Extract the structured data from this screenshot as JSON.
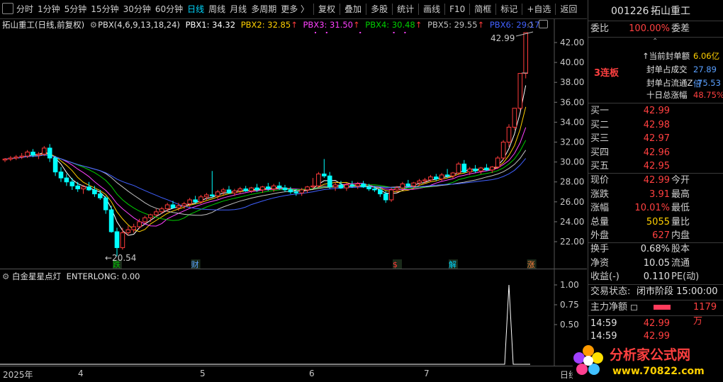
{
  "toolbar": {
    "items": [
      {
        "label": "分时",
        "selected": false
      },
      {
        "label": "1分钟",
        "selected": false
      },
      {
        "label": "5分钟",
        "selected": false
      },
      {
        "label": "15分钟",
        "selected": false
      },
      {
        "label": "30分钟",
        "selected": false
      },
      {
        "label": "60分钟",
        "selected": false
      },
      {
        "label": "日线",
        "selected": true
      },
      {
        "label": "周线",
        "selected": false
      },
      {
        "label": "月线",
        "selected": false
      },
      {
        "label": "多周期",
        "selected": false
      },
      {
        "label": "更多 〉",
        "selected": false
      }
    ],
    "actions": [
      "复权",
      "叠加",
      "多股",
      "统计",
      "画线",
      "F10",
      "简框",
      "标记",
      "+自选",
      "返回"
    ]
  },
  "chart_info": {
    "stock_name": "拓山重工",
    "mode": "(日线,前复权)",
    "indicator": "PBX(4,6,9,13,18,24)",
    "pbx1": "PBX1: 34.32",
    "pbx2": "PBX2: 32.85",
    "pbx3": "PBX3: 31.50",
    "pbx4": "PBX4: 30.48",
    "pbx5": "PBX5: 29.55",
    "pbx6": "PBX6: 29.17",
    "arrow": "↑",
    "high_label": "42.99",
    "low_label": "←20.54"
  },
  "colors": {
    "up": "#ff3b3b",
    "down": "#00ffff",
    "pbx1": "#ffffff",
    "pbx2": "#ffd000",
    "pbx3": "#ff40ff",
    "pbx4": "#00d000",
    "pbx5": "#c0c0c0",
    "pbx6": "#4060ff"
  },
  "chart_data": {
    "type": "candlestick",
    "y_ticks": [
      "42.00",
      "40.00",
      "38.00",
      "36.00",
      "34.00",
      "32.00",
      "30.00",
      "28.00",
      "26.00",
      "24.00",
      "22.00"
    ],
    "ylim": [
      20.5,
      43.2
    ],
    "x_labels": [
      "2025年",
      "4",
      "5",
      "6",
      "7",
      "日线"
    ],
    "candles": [
      [
        30.2,
        30.4,
        30.0,
        30.3
      ],
      [
        30.3,
        30.6,
        30.1,
        30.4
      ],
      [
        30.4,
        30.7,
        30.2,
        30.5
      ],
      [
        30.5,
        30.9,
        30.3,
        30.6
      ],
      [
        30.6,
        31.2,
        30.4,
        31.0
      ],
      [
        31.0,
        31.3,
        30.5,
        30.7
      ],
      [
        30.7,
        31.0,
        30.3,
        30.8
      ],
      [
        30.8,
        31.6,
        30.6,
        31.4
      ],
      [
        31.4,
        31.8,
        30.0,
        30.4
      ],
      [
        30.4,
        30.6,
        28.6,
        29.0
      ],
      [
        29.0,
        29.5,
        28.0,
        28.4
      ],
      [
        28.4,
        28.8,
        27.6,
        28.0
      ],
      [
        28.0,
        28.4,
        27.2,
        27.6
      ],
      [
        27.6,
        28.0,
        27.0,
        27.3
      ],
      [
        27.3,
        27.7,
        26.8,
        27.5
      ],
      [
        27.5,
        28.0,
        27.1,
        27.2
      ],
      [
        27.2,
        27.6,
        26.5,
        26.8
      ],
      [
        26.8,
        27.2,
        26.2,
        26.4
      ],
      [
        26.4,
        26.6,
        24.8,
        25.2
      ],
      [
        25.2,
        25.6,
        22.9,
        23.0
      ],
      [
        23.0,
        23.4,
        20.54,
        21.4
      ],
      [
        21.4,
        23.4,
        21.2,
        22.9
      ],
      [
        22.9,
        23.6,
        22.6,
        23.2
      ],
      [
        23.2,
        23.8,
        22.9,
        23.5
      ],
      [
        23.5,
        24.3,
        23.3,
        24.0
      ],
      [
        24.0,
        24.6,
        23.8,
        24.4
      ],
      [
        24.4,
        24.8,
        24.0,
        24.7
      ],
      [
        24.7,
        25.3,
        24.5,
        25.0
      ],
      [
        25.0,
        25.5,
        24.8,
        25.3
      ],
      [
        25.3,
        25.9,
        25.0,
        25.7
      ],
      [
        25.7,
        26.1,
        25.3,
        25.4
      ],
      [
        25.4,
        25.9,
        25.1,
        25.6
      ],
      [
        25.6,
        26.0,
        25.3,
        25.8
      ],
      [
        25.8,
        26.4,
        25.5,
        26.2
      ],
      [
        26.2,
        26.6,
        25.8,
        26.0
      ],
      [
        26.0,
        26.7,
        25.8,
        26.5
      ],
      [
        26.5,
        26.9,
        26.2,
        26.7
      ],
      [
        26.7,
        29.1,
        26.4,
        26.6
      ],
      [
        26.6,
        27.2,
        26.3,
        27.0
      ],
      [
        27.0,
        27.4,
        26.7,
        27.2
      ],
      [
        27.2,
        27.6,
        26.8,
        26.9
      ],
      [
        26.9,
        27.3,
        26.6,
        27.1
      ],
      [
        27.1,
        27.5,
        26.8,
        27.3
      ],
      [
        27.3,
        27.6,
        27.0,
        27.1
      ],
      [
        27.1,
        27.5,
        26.9,
        27.4
      ],
      [
        27.4,
        27.8,
        27.0,
        27.2
      ],
      [
        27.2,
        27.6,
        26.9,
        27.5
      ],
      [
        27.5,
        27.9,
        27.1,
        27.3
      ],
      [
        27.3,
        27.8,
        27.0,
        27.6
      ],
      [
        27.6,
        28.0,
        27.2,
        27.4
      ],
      [
        27.4,
        27.7,
        27.0,
        27.2
      ],
      [
        27.2,
        27.5,
        26.8,
        27.0
      ],
      [
        27.0,
        27.3,
        26.6,
        26.9
      ],
      [
        26.9,
        27.4,
        26.6,
        27.2
      ],
      [
        27.2,
        27.6,
        26.9,
        27.5
      ],
      [
        27.5,
        28.4,
        27.3,
        27.6
      ],
      [
        27.6,
        29.0,
        27.4,
        28.8
      ],
      [
        28.8,
        30.3,
        28.4,
        28.6
      ],
      [
        28.6,
        29.0,
        27.3,
        27.5
      ],
      [
        27.5,
        28.0,
        27.1,
        27.7
      ],
      [
        27.7,
        28.1,
        27.3,
        27.4
      ],
      [
        27.4,
        27.9,
        27.1,
        27.7
      ],
      [
        27.7,
        28.1,
        27.4,
        27.6
      ],
      [
        27.6,
        28.0,
        27.3,
        27.8
      ],
      [
        27.8,
        28.1,
        27.4,
        27.5
      ],
      [
        27.5,
        27.8,
        27.1,
        27.3
      ],
      [
        27.3,
        27.6,
        27.0,
        27.2
      ],
      [
        27.2,
        27.5,
        26.5,
        26.8
      ],
      [
        26.8,
        27.1,
        25.9,
        26.2
      ],
      [
        26.2,
        27.4,
        26.0,
        27.2
      ],
      [
        27.2,
        27.6,
        26.9,
        27.4
      ],
      [
        27.4,
        28.0,
        27.2,
        27.8
      ],
      [
        27.8,
        28.2,
        27.5,
        27.6
      ],
      [
        27.6,
        28.0,
        27.3,
        27.9
      ],
      [
        27.9,
        28.3,
        27.6,
        28.1
      ],
      [
        28.1,
        28.4,
        27.8,
        28.2
      ],
      [
        28.2,
        28.7,
        28.0,
        28.5
      ],
      [
        28.5,
        28.8,
        28.1,
        28.3
      ],
      [
        28.3,
        28.9,
        28.1,
        28.7
      ],
      [
        28.7,
        29.3,
        28.4,
        28.6
      ],
      [
        28.6,
        29.0,
        28.3,
        28.9
      ],
      [
        28.9,
        30.0,
        28.7,
        29.8
      ],
      [
        29.8,
        30.2,
        28.9,
        29.0
      ],
      [
        29.0,
        29.5,
        28.7,
        29.3
      ],
      [
        29.3,
        29.7,
        28.9,
        29.1
      ],
      [
        29.1,
        29.5,
        28.8,
        29.4
      ],
      [
        29.4,
        29.8,
        29.1,
        29.2
      ],
      [
        29.2,
        29.6,
        28.9,
        29.5
      ],
      [
        29.5,
        30.6,
        29.3,
        30.4
      ],
      [
        30.4,
        32.2,
        30.2,
        32.0
      ],
      [
        32.0,
        33.8,
        31.5,
        33.5
      ],
      [
        33.5,
        35.4,
        33.2,
        35.4
      ],
      [
        35.4,
        38.9,
        35.2,
        38.9
      ],
      [
        38.9,
        42.99,
        38.4,
        42.99
      ]
    ],
    "sub_indicator": {
      "name": "白金星星点灯",
      "value_label": "ENTERLONG: 0.00",
      "y_ticks": [
        "1.00",
        "0.75",
        "0.50"
      ],
      "signal_index": 90,
      "signal_value": 1.0
    },
    "event_markers": [
      {
        "label": "跌",
        "index": 20
      },
      {
        "label": "财",
        "index": 34
      },
      {
        "label": "$",
        "index": 70
      },
      {
        "label": "解",
        "index": 80
      },
      {
        "label": "涨",
        "index": 94
      }
    ]
  },
  "quote": {
    "code": "001226",
    "name": "拓山重工",
    "weibi_label": "委比",
    "weibi": "100.00%",
    "weicha_label": "委差",
    "seal_amount_label": "当前封单额",
    "seal_amount": "6.06亿",
    "seal_trade_label": "封单占成交",
    "seal_trade": "27.89倍",
    "seal_float_label": "封单占流通Z",
    "seal_float": "75.53",
    "ten_day_label": "十日总涨幅",
    "ten_day": "48.75%",
    "streak": "3连板",
    "bids": [
      {
        "label": "买一",
        "price": "42.99"
      },
      {
        "label": "买二",
        "price": "42.98"
      },
      {
        "label": "买三",
        "price": "42.97"
      },
      {
        "label": "买四",
        "price": "42.96"
      },
      {
        "label": "买五",
        "price": "42.95"
      }
    ],
    "stats": [
      {
        "l1": "现价",
        "v1": "42.99",
        "l2": "今开",
        "c": "red"
      },
      {
        "l1": "涨跌",
        "v1": "3.91",
        "l2": "最高",
        "c": "red"
      },
      {
        "l1": "涨幅",
        "v1": "10.01%",
        "l2": "最低",
        "c": "red"
      },
      {
        "l1": "总量",
        "v1": "5055",
        "l2": "量比",
        "c": "yel"
      },
      {
        "l1": "外盘",
        "v1": "627",
        "l2": "内盘",
        "c": "red"
      }
    ],
    "stats2": [
      {
        "l1": "换手",
        "v1": "0.68%",
        "l2": "股本"
      },
      {
        "l1": "净资",
        "v1": "10.05",
        "l2": "流通"
      },
      {
        "l1": "收益(-)",
        "v1": "0.110",
        "l2": "PE(动)"
      }
    ],
    "trade_status_label": "交易状态:",
    "trade_status": "闭市阶段 15:00:00",
    "main_net_label": "主力净额",
    "main_net": "1179万",
    "ticks": [
      {
        "time": "14:59",
        "price": "42.99"
      },
      {
        "time": "14:59",
        "price": "42.99"
      }
    ]
  },
  "watermark": {
    "title": "分析家公式网",
    "url": "www.70822.com"
  }
}
